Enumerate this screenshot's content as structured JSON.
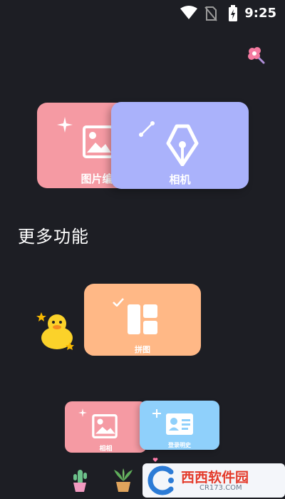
{
  "status_bar": {
    "time": "9:25"
  },
  "cards": {
    "picture_edit": {
      "label": "图片编"
    },
    "camera": {
      "label": "相机"
    },
    "collage": {
      "label": "拼图"
    },
    "album": {
      "label": "相相"
    },
    "id_photo": {
      "label": "登录明史"
    }
  },
  "section": {
    "title": "更多功能"
  },
  "watermark": {
    "text": "西西软件园",
    "sub": "CR173.COM"
  },
  "colors": {
    "background": "#1d1e24",
    "pink": "#f59aa3",
    "lavender": "#aab2fb",
    "orange": "#ffb886",
    "light_blue": "#8fd0fb"
  },
  "icons": [
    "wifi-icon",
    "no-sim-icon",
    "battery-charging-icon",
    "flower-sticker-icon",
    "sparkle-icon",
    "image-icon",
    "pen-nib-icon",
    "checkmark-icon",
    "collage-grid-icon",
    "duck-sticker-icon",
    "plus-icon",
    "id-card-icon",
    "cactus-sticker-icon",
    "plant-sticker-icon"
  ]
}
